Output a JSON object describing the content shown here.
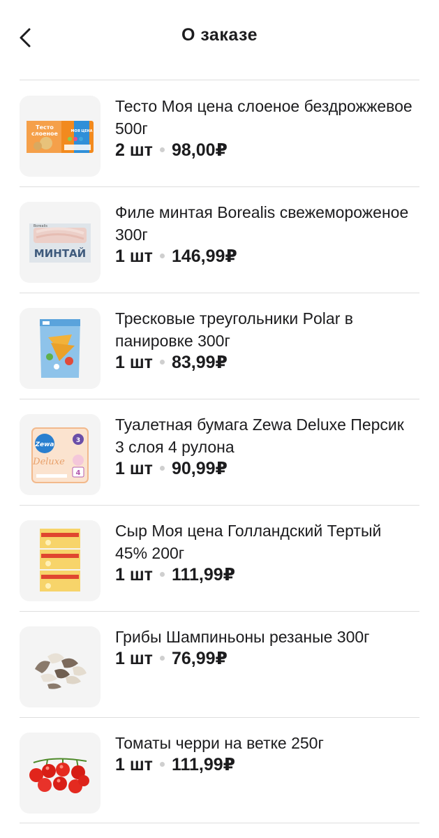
{
  "header": {
    "title": "О заказе"
  },
  "items": [
    {
      "name": "Тесто Моя цена слоеное бездрожжевое 500г",
      "qty": "2 шт",
      "price": "98,00₽"
    },
    {
      "name": "Филе минтая Borealis свежемороженое 300г",
      "qty": "1 шт",
      "price": "146,99₽"
    },
    {
      "name": "Тресковые треугольники Polar в панировке 300г",
      "qty": "1 шт",
      "price": "83,99₽"
    },
    {
      "name": "Туалетная бумага Zewa Deluxe Персик 3 слоя 4 рулона",
      "qty": "1 шт",
      "price": "90,99₽"
    },
    {
      "name": "Сыр Моя цена Голландский Тертый 45% 200г",
      "qty": "1 шт",
      "price": "111,99₽"
    },
    {
      "name": "Грибы Шампиньоны резаные 300г",
      "qty": "1 шт",
      "price": "76,99₽"
    },
    {
      "name": "Томаты черри на ветке 250г",
      "qty": "1 шт",
      "price": "111,99₽"
    }
  ],
  "package_text": {
    "dough": [
      "Тесто",
      "слоеное"
    ],
    "dough_brand": "МОЯ ЦЕНА",
    "pollock": "МИНТАЙ",
    "pollock_brand": "Borealis",
    "zewa_logo": "Zewa",
    "zewa_line": "Deluxe",
    "zewa_layers": "3",
    "zewa_rolls": "4"
  },
  "colors": {
    "accent_orange": "#f28a1e",
    "text": "#1c1c1e",
    "divider": "#dedede",
    "thumb_bg": "#f4f4f4"
  }
}
